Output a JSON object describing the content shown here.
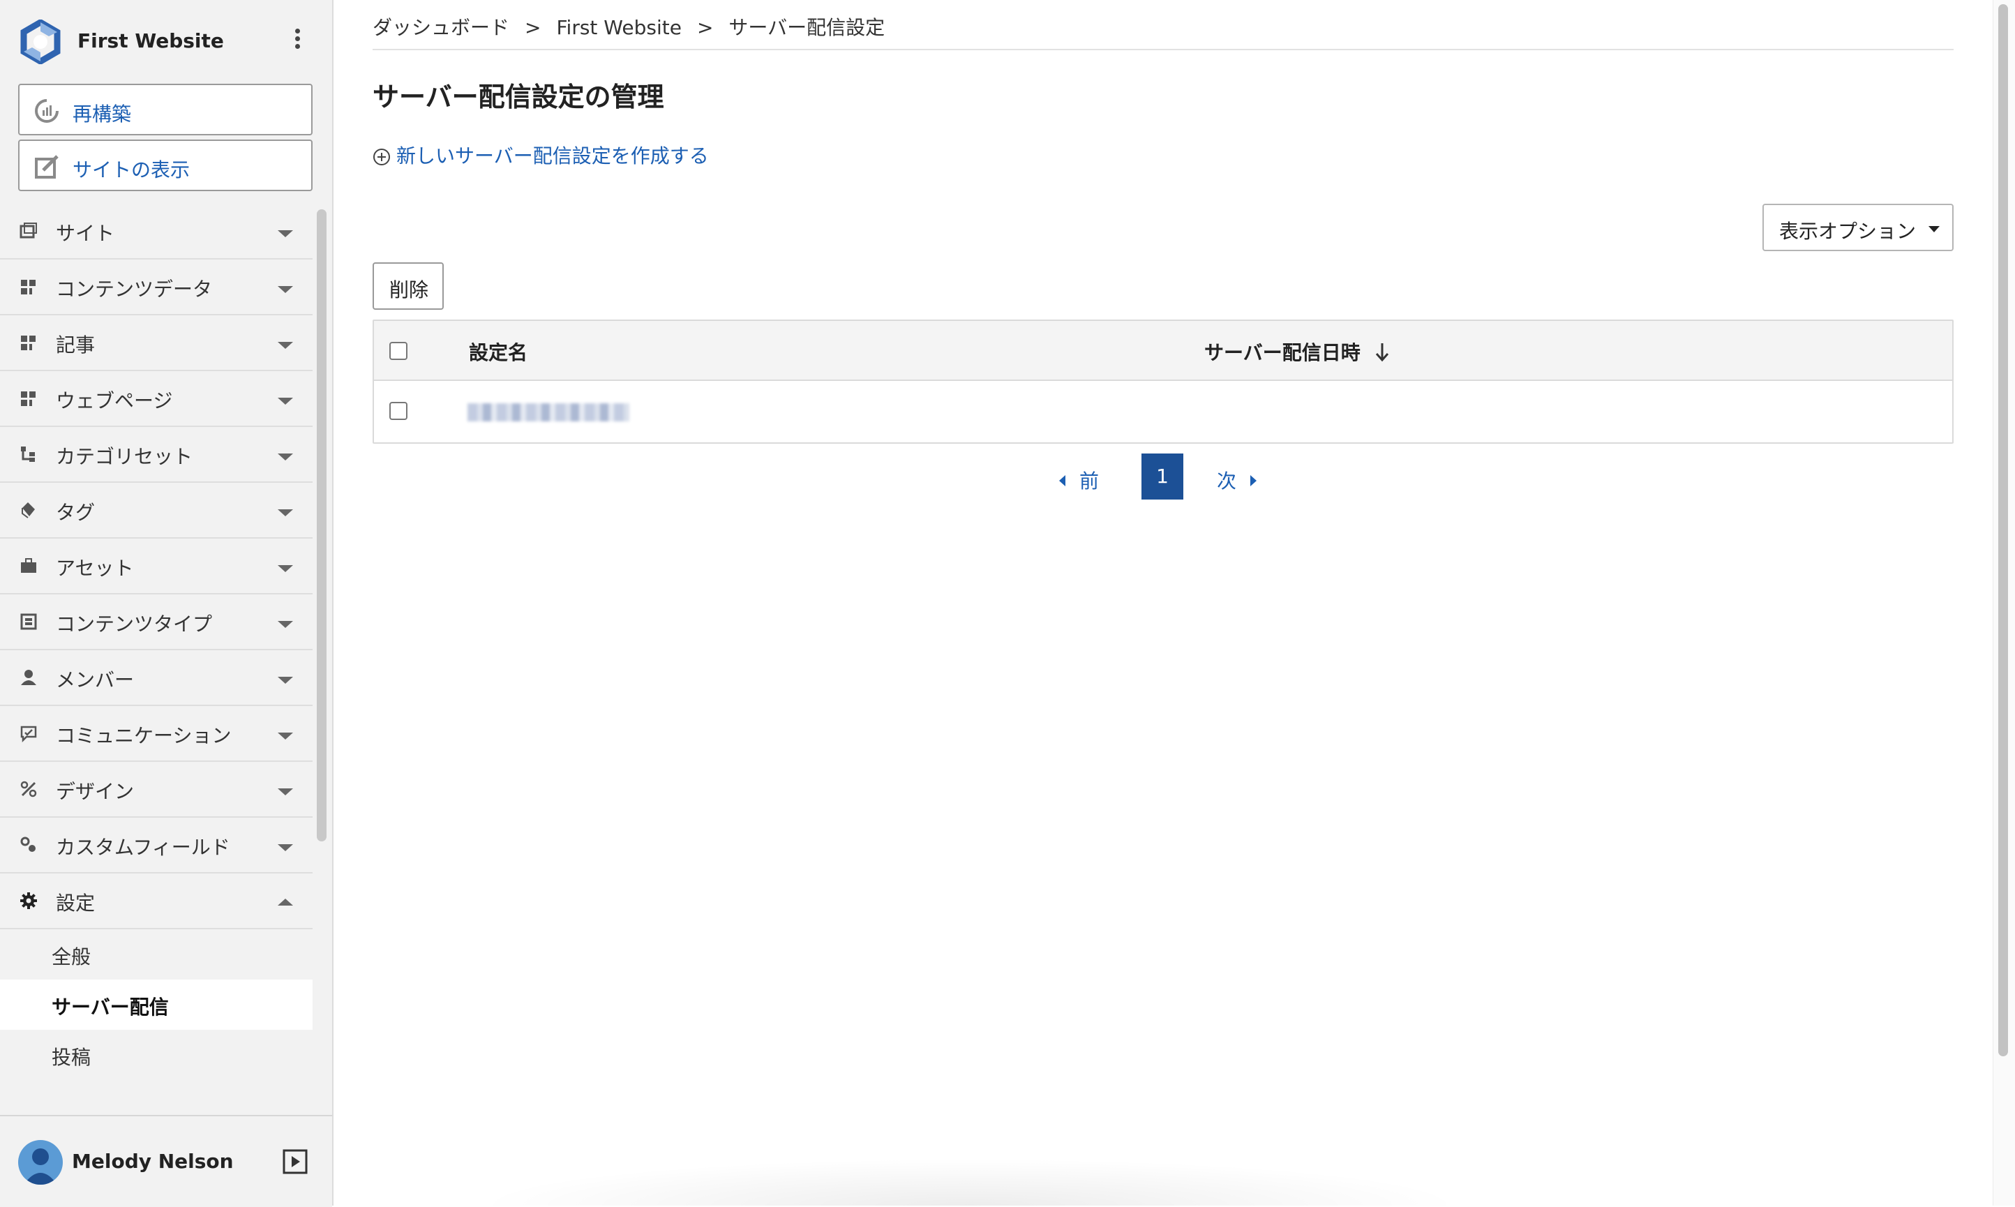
{
  "site": {
    "name": "First Website"
  },
  "sidebar": {
    "rebuild_label": "再構築",
    "view_site_label": "サイトの表示",
    "menu": [
      {
        "label": "サイト",
        "icon": "site-icon",
        "expanded": false
      },
      {
        "label": "コンテンツデータ",
        "icon": "content-data-icon",
        "expanded": false
      },
      {
        "label": "記事",
        "icon": "entry-icon",
        "expanded": false
      },
      {
        "label": "ウェブページ",
        "icon": "webpage-icon",
        "expanded": false
      },
      {
        "label": "カテゴリセット",
        "icon": "category-set-icon",
        "expanded": false
      },
      {
        "label": "タグ",
        "icon": "tag-icon",
        "expanded": false
      },
      {
        "label": "アセット",
        "icon": "asset-icon",
        "expanded": false
      },
      {
        "label": "コンテンツタイプ",
        "icon": "content-type-icon",
        "expanded": false
      },
      {
        "label": "メンバー",
        "icon": "member-icon",
        "expanded": false
      },
      {
        "label": "コミュニケーション",
        "icon": "communication-icon",
        "expanded": false
      },
      {
        "label": "デザイン",
        "icon": "design-icon",
        "expanded": false
      },
      {
        "label": "カスタムフィールド",
        "icon": "custom-field-icon",
        "expanded": false
      },
      {
        "label": "設定",
        "icon": "gear-icon",
        "expanded": true
      }
    ],
    "submenu": [
      {
        "label": "全般",
        "active": false
      },
      {
        "label": "サーバー配信",
        "active": true
      },
      {
        "label": "投稿",
        "active": false
      }
    ]
  },
  "user": {
    "name": "Melody Nelson"
  },
  "breadcrumb": {
    "items": [
      "ダッシュボード",
      "First Website",
      "サーバー配信設定"
    ],
    "separator": ">"
  },
  "page": {
    "title": "サーバー配信設定の管理",
    "create_link": "新しいサーバー配信設定を作成する",
    "display_options_label": "表示オプション",
    "delete_label": "削除"
  },
  "table": {
    "columns": [
      "設定名",
      "サーバー配信日時"
    ],
    "sort_column": "サーバー配信日時",
    "sort_direction": "desc",
    "rows": [
      {
        "name_redacted": true,
        "date": ""
      }
    ]
  },
  "pagination": {
    "prev_label": "前",
    "current_page": "1",
    "next_label": "次"
  },
  "colors": {
    "accent": "#1c5fb3",
    "page_active": "#1c5096",
    "sidebar_bg": "#f2f2f2"
  }
}
